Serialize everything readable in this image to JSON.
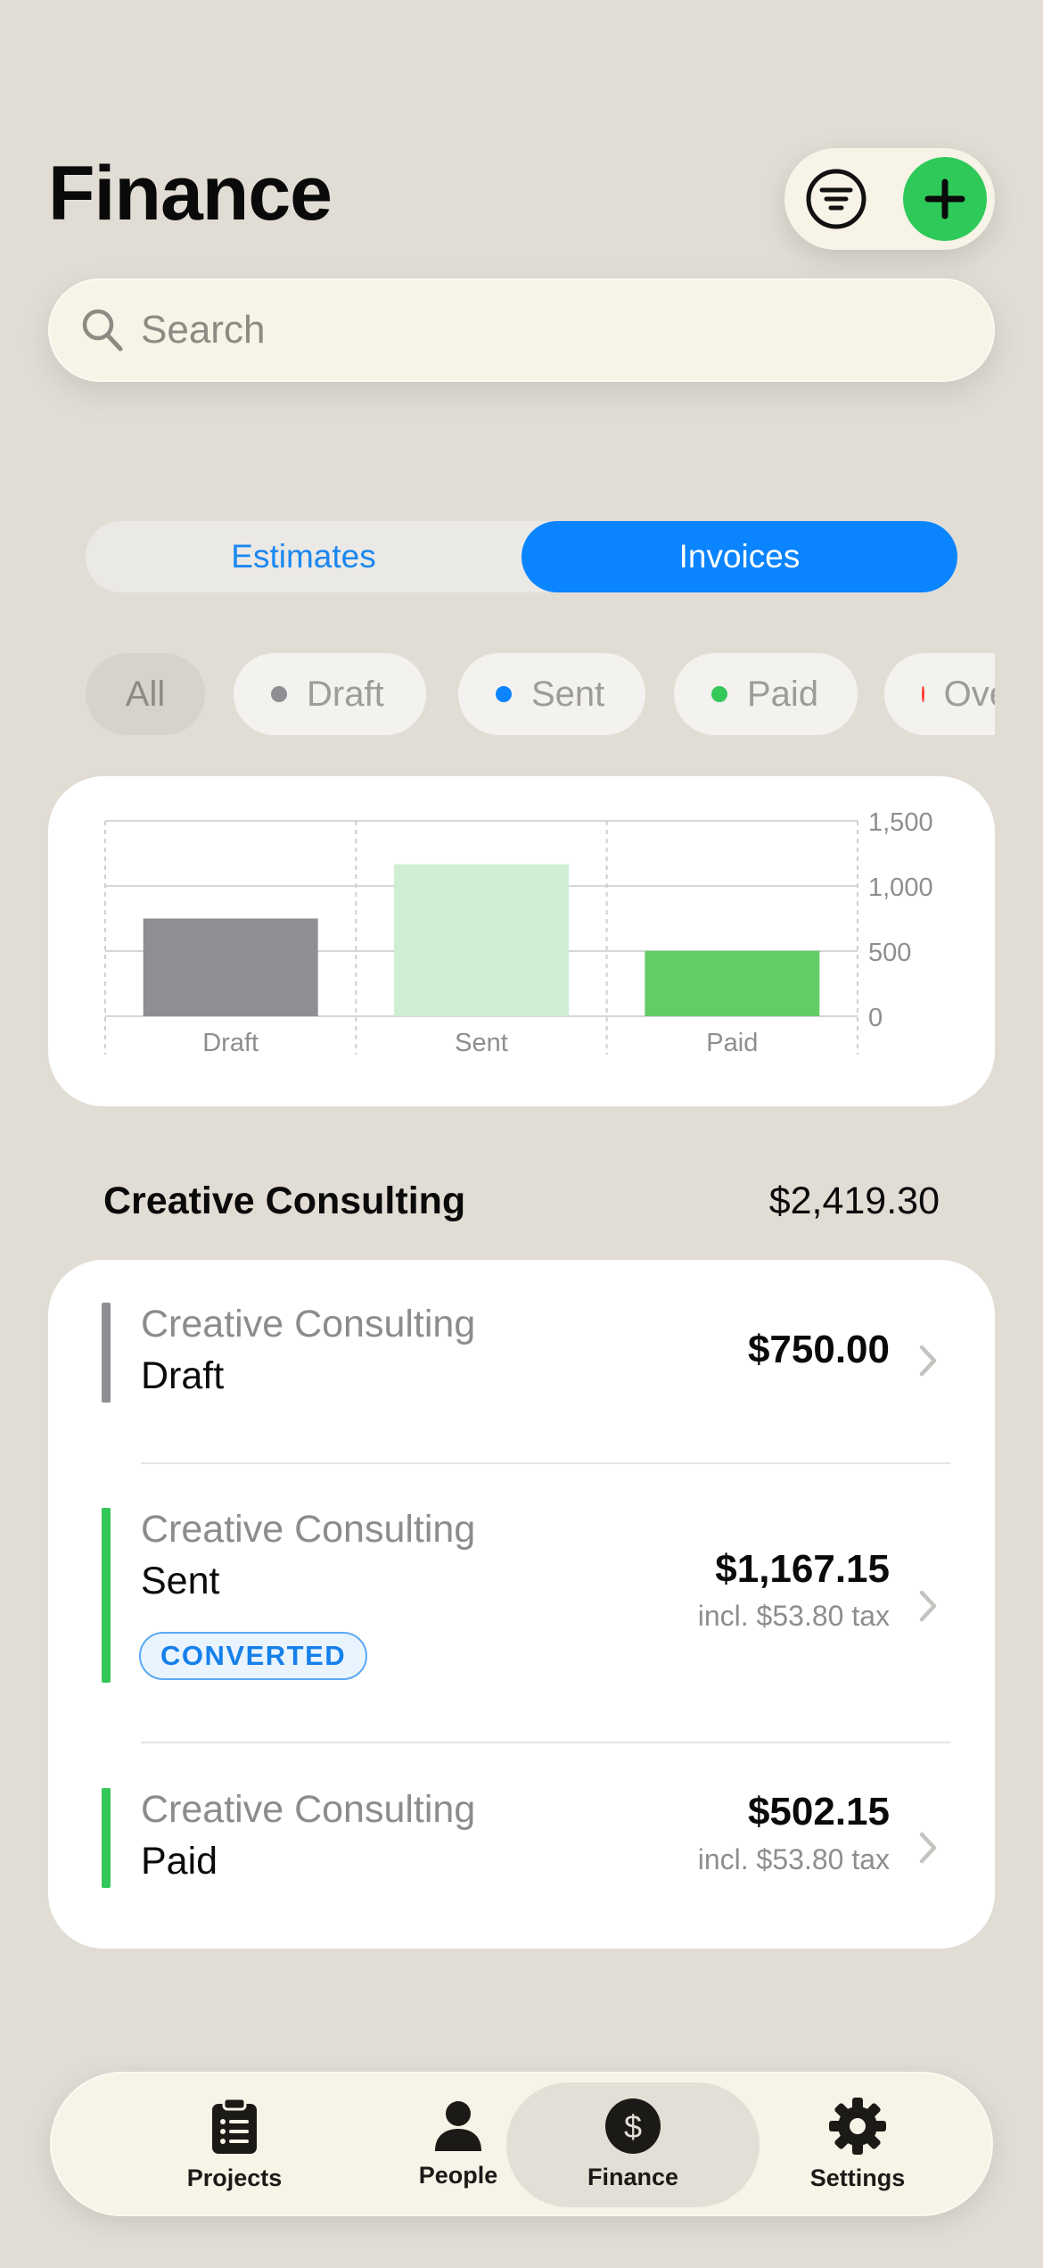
{
  "header": {
    "title": "Finance"
  },
  "actions": {
    "filter_icon": "filter-circle-icon",
    "add_icon": "plus-icon",
    "add_color": "#2fc95a"
  },
  "search": {
    "placeholder": "Search"
  },
  "segments": [
    {
      "label": "Estimates",
      "selected": false
    },
    {
      "label": "Invoices",
      "selected": true
    }
  ],
  "filters": [
    {
      "label": "All",
      "dot": null,
      "selected": true
    },
    {
      "label": "Draft",
      "dot": "#8e8e93"
    },
    {
      "label": "Sent",
      "dot": "#0a84ff"
    },
    {
      "label": "Paid",
      "dot": "#34c759"
    },
    {
      "label": "Overdue",
      "dot": "#ff3b30"
    }
  ],
  "chart_data": {
    "type": "bar",
    "categories": [
      "Draft",
      "Sent",
      "Paid"
    ],
    "values": [
      750.0,
      1167.15,
      502.15
    ],
    "colors": [
      "#8e8e93",
      "#d0eed4",
      "#63cc66"
    ],
    "ylim": [
      0,
      1500
    ],
    "yticks": [
      "1,500",
      "1,000",
      "500",
      "0"
    ],
    "ytick_values": [
      1500,
      1000,
      500,
      0
    ],
    "grid": true,
    "title": "",
    "xlabel": "",
    "ylabel": ""
  },
  "group": {
    "title": "Creative Consulting",
    "total": "$2,419.30"
  },
  "invoices": [
    {
      "client": "Creative Consulting",
      "status": "Draft",
      "amount": "$750.00",
      "tax": "",
      "badge": "",
      "bar_color": "#8e8e93"
    },
    {
      "client": "Creative Consulting",
      "status": "Sent",
      "amount": "$1,167.15",
      "tax": "incl. $53.80 tax",
      "badge": "CONVERTED",
      "bar_color": "#34c759"
    },
    {
      "client": "Creative Consulting",
      "status": "Paid",
      "amount": "$502.15",
      "tax": "incl. $53.80 tax",
      "badge": "",
      "bar_color": "#34c759"
    }
  ],
  "tabs": [
    {
      "label": "Projects",
      "icon": "clipboard-icon",
      "active": false
    },
    {
      "label": "People",
      "icon": "person-icon",
      "active": false
    },
    {
      "label": "Finance",
      "icon": "dollar-circle-icon",
      "active": true
    },
    {
      "label": "Settings",
      "icon": "gear-icon",
      "active": false
    }
  ]
}
